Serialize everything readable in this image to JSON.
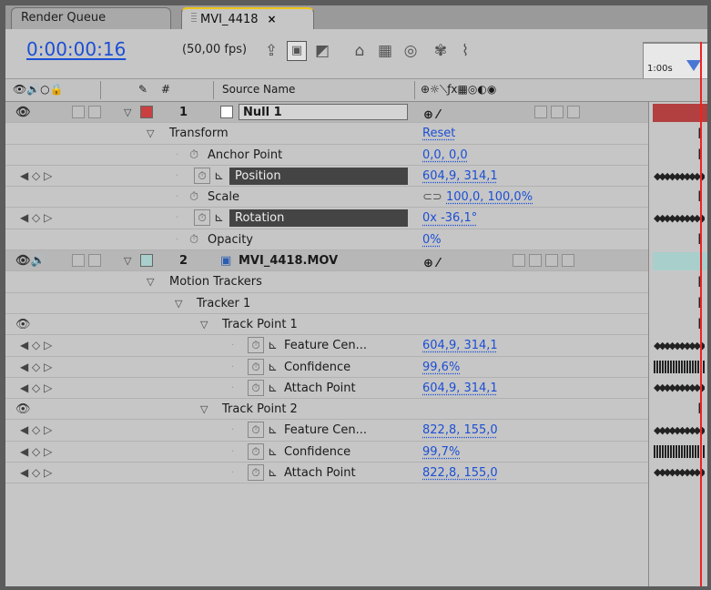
{
  "tabs": {
    "render_queue": "Render Queue",
    "comp": "MVI_4418",
    "close": "×"
  },
  "header": {
    "timecode": "0:00:00:16",
    "fps": "(50,00 fps)",
    "ruler_label": "1:00s"
  },
  "columns": {
    "hash": "#",
    "source_name": "Source Name"
  },
  "rows": [
    {
      "type": "layer",
      "num": "1",
      "name": "Null 1",
      "label_color": "#c84040"
    },
    {
      "type": "group",
      "name": "Transform",
      "value": "Reset"
    },
    {
      "type": "prop",
      "name": "Anchor Point",
      "value": "0,0, 0,0"
    },
    {
      "type": "prop-kf",
      "name": "Position",
      "value": "604,9, 314,1"
    },
    {
      "type": "prop",
      "name": "Scale",
      "value": "100,0, 100,0%"
    },
    {
      "type": "prop-kf",
      "name": "Rotation",
      "value": "0x -36,1°"
    },
    {
      "type": "prop",
      "name": "Opacity",
      "value": "0%"
    },
    {
      "type": "layer",
      "num": "2",
      "name": "MVI_4418.MOV",
      "label_color": "#a8cfcc"
    },
    {
      "type": "group",
      "name": "Motion Trackers"
    },
    {
      "type": "group2",
      "name": "Tracker 1"
    },
    {
      "type": "group3",
      "name": "Track Point 1"
    },
    {
      "type": "tp",
      "name": "Feature Cen...",
      "value": "604,9, 314,1"
    },
    {
      "type": "tp",
      "name": "Confidence",
      "value": "99,6%"
    },
    {
      "type": "tp",
      "name": "Attach Point",
      "value": "604,9, 314,1"
    },
    {
      "type": "group3",
      "name": "Track Point 2"
    },
    {
      "type": "tp",
      "name": "Feature Cen...",
      "value": "822,8, 155,0"
    },
    {
      "type": "tp",
      "name": "Confidence",
      "value": "99,7%"
    },
    {
      "type": "tp",
      "name": "Attach Point",
      "value": "822,8, 155,0"
    }
  ],
  "colors": {
    "accent_blue": "#1c4fd4",
    "cti_red": "#e22222",
    "tab_highlight": "#f0c419"
  }
}
